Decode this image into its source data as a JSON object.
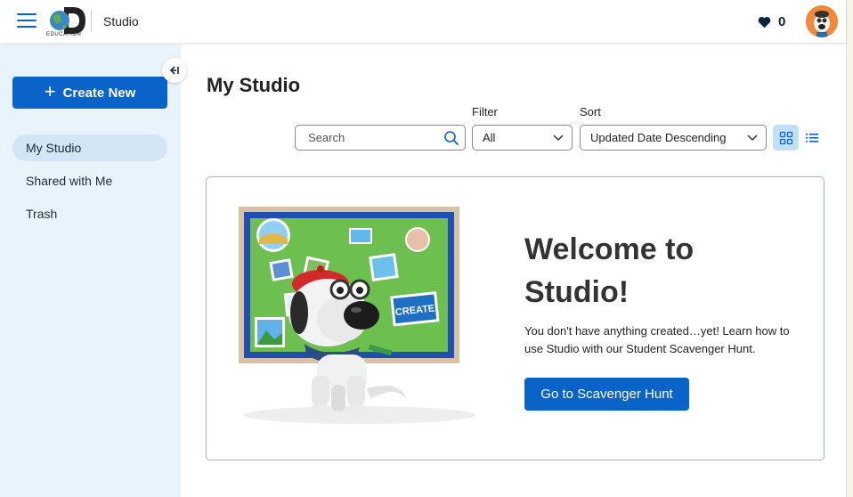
{
  "header": {
    "logo_text": "EDUCATION",
    "app_title": "Studio",
    "favorites_count": "0"
  },
  "sidebar": {
    "create_label": "Create New",
    "items": [
      {
        "label": "My Studio",
        "active": true
      },
      {
        "label": "Shared with Me",
        "active": false
      },
      {
        "label": "Trash",
        "active": false
      }
    ]
  },
  "main": {
    "title": "My Studio",
    "search": {
      "placeholder": "Search"
    },
    "filter": {
      "label": "Filter",
      "value": "All"
    },
    "sort": {
      "label": "Sort",
      "value": "Updated Date Descending"
    }
  },
  "empty_state": {
    "title_line1": "Welcome to",
    "title_line2": "Studio!",
    "description": "You don't have anything created…yet! Learn how to use Studio with our Student Scavenger Hunt.",
    "button_label": "Go to Scavenger Hunt",
    "board_sign_text": "CREATE"
  },
  "colors": {
    "primary": "#0a63c9",
    "sidebar_bg": "#e9f3fb",
    "active_item_bg": "#d2e6f6",
    "view_toggle_active": "#bfe0f7"
  }
}
